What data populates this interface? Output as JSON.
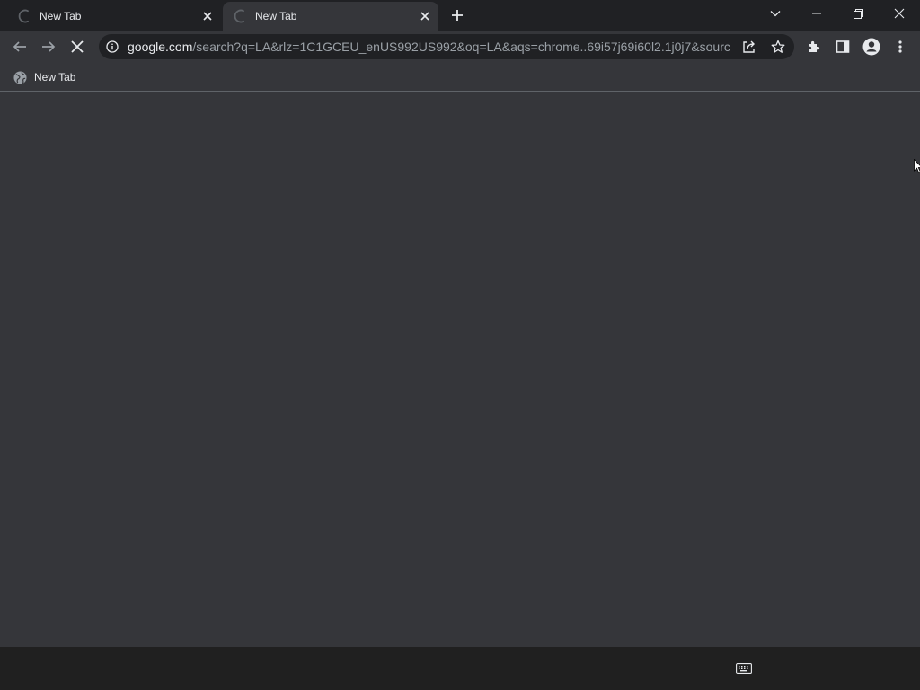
{
  "tabs": [
    {
      "title": "New Tab",
      "state": "loading",
      "active": false
    },
    {
      "title": "New Tab",
      "state": "loading",
      "active": true
    }
  ],
  "window_controls": {
    "tab_search": "chevron-down-icon",
    "minimize": "minimize-icon",
    "restore": "restore-icon",
    "close": "close-icon"
  },
  "toolbar": {
    "url_host": "google.com",
    "url_rest": "/search?q=LA&rlz=1C1GCEU_enUS992US992&oq=LA&aqs=chrome..69i57j69i60l2.1j0j7&sourc...",
    "reload_state": "stop"
  },
  "bookmarks": [
    {
      "label": "New Tab",
      "icon": "globe-icon"
    }
  ],
  "colors": {
    "frame": "#202124",
    "toolbar": "#35363a",
    "text": "#e8eaed",
    "muted": "#9aa0a6",
    "taskbar": "#202020"
  }
}
